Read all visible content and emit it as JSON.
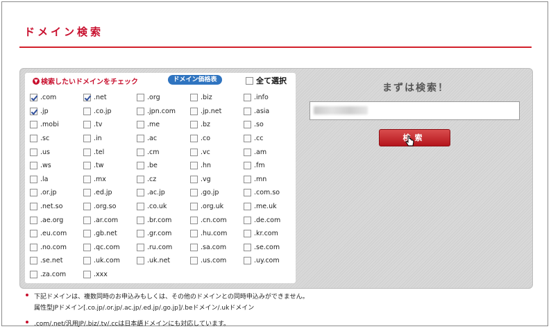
{
  "page": {
    "title": "ドメイン検索"
  },
  "domain_box": {
    "heading": "検索したいドメインをチェック",
    "price_button": "ドメイン価格表",
    "select_all_label": "全て選択",
    "items": [
      {
        "label": ".com",
        "checked": true
      },
      {
        "label": ".net",
        "checked": true
      },
      {
        "label": ".org",
        "checked": false
      },
      {
        "label": ".biz",
        "checked": false
      },
      {
        "label": ".info",
        "checked": false
      },
      {
        "label": ".jp",
        "checked": true
      },
      {
        "label": ".co.jp",
        "checked": false
      },
      {
        "label": ".jpn.com",
        "checked": false
      },
      {
        "label": ".jp.net",
        "checked": false
      },
      {
        "label": ".asia",
        "checked": false
      },
      {
        "label": ".mobi",
        "checked": false
      },
      {
        "label": ".tv",
        "checked": false
      },
      {
        "label": ".me",
        "checked": false
      },
      {
        "label": ".bz",
        "checked": false
      },
      {
        "label": ".so",
        "checked": false
      },
      {
        "label": ".sc",
        "checked": false
      },
      {
        "label": ".in",
        "checked": false
      },
      {
        "label": ".ac",
        "checked": false
      },
      {
        "label": ".co",
        "checked": false
      },
      {
        "label": ".cc",
        "checked": false
      },
      {
        "label": ".us",
        "checked": false
      },
      {
        "label": ".tel",
        "checked": false
      },
      {
        "label": ".cm",
        "checked": false
      },
      {
        "label": ".vc",
        "checked": false
      },
      {
        "label": ".am",
        "checked": false
      },
      {
        "label": ".ws",
        "checked": false
      },
      {
        "label": ".tw",
        "checked": false
      },
      {
        "label": ".be",
        "checked": false
      },
      {
        "label": ".hn",
        "checked": false
      },
      {
        "label": ".fm",
        "checked": false
      },
      {
        "label": ".la",
        "checked": false
      },
      {
        "label": ".mx",
        "checked": false
      },
      {
        "label": ".cz",
        "checked": false
      },
      {
        "label": ".vg",
        "checked": false
      },
      {
        "label": ".mn",
        "checked": false
      },
      {
        "label": ".or.jp",
        "checked": false
      },
      {
        "label": ".ed.jp",
        "checked": false
      },
      {
        "label": ".ac.jp",
        "checked": false
      },
      {
        "label": ".go.jp",
        "checked": false
      },
      {
        "label": ".com.so",
        "checked": false
      },
      {
        "label": ".net.so",
        "checked": false
      },
      {
        "label": ".org.so",
        "checked": false
      },
      {
        "label": ".co.uk",
        "checked": false
      },
      {
        "label": ".org.uk",
        "checked": false
      },
      {
        "label": ".me.uk",
        "checked": false
      },
      {
        "label": ".ae.org",
        "checked": false
      },
      {
        "label": ".ar.com",
        "checked": false
      },
      {
        "label": ".br.com",
        "checked": false
      },
      {
        "label": ".cn.com",
        "checked": false
      },
      {
        "label": ".de.com",
        "checked": false
      },
      {
        "label": ".eu.com",
        "checked": false
      },
      {
        "label": ".gb.net",
        "checked": false
      },
      {
        "label": ".gr.com",
        "checked": false
      },
      {
        "label": ".hu.com",
        "checked": false
      },
      {
        "label": ".kr.com",
        "checked": false
      },
      {
        "label": ".no.com",
        "checked": false
      },
      {
        "label": ".qc.com",
        "checked": false
      },
      {
        "label": ".ru.com",
        "checked": false
      },
      {
        "label": ".sa.com",
        "checked": false
      },
      {
        "label": ".se.com",
        "checked": false
      },
      {
        "label": ".se.net",
        "checked": false
      },
      {
        "label": ".uk.com",
        "checked": false
      },
      {
        "label": ".uk.net",
        "checked": false
      },
      {
        "label": ".us.com",
        "checked": false
      },
      {
        "label": ".uy.com",
        "checked": false
      },
      {
        "label": ".za.com",
        "checked": false
      },
      {
        "label": ".xxx",
        "checked": false
      }
    ]
  },
  "search": {
    "heading": "まずは検索！",
    "input_value": "",
    "button_label": "検索"
  },
  "notes": {
    "note1_line1": "下記ドメインは、複数同時のお申込みもしくは、その他のドメインとの同時申込みができません。",
    "note1_line2": "属性型JPドメイン[.co.jp/.or.jp/.ac.jp/.ed.jp/.go.jp]/.beドメイン/.ukドメイン",
    "note2": ".com/.net/汎用JP/.biz/.tv/.ccは日本語ドメインにも対応しています。"
  },
  "colors": {
    "accent": "#c8102e",
    "price_button": "#2f74c0"
  }
}
